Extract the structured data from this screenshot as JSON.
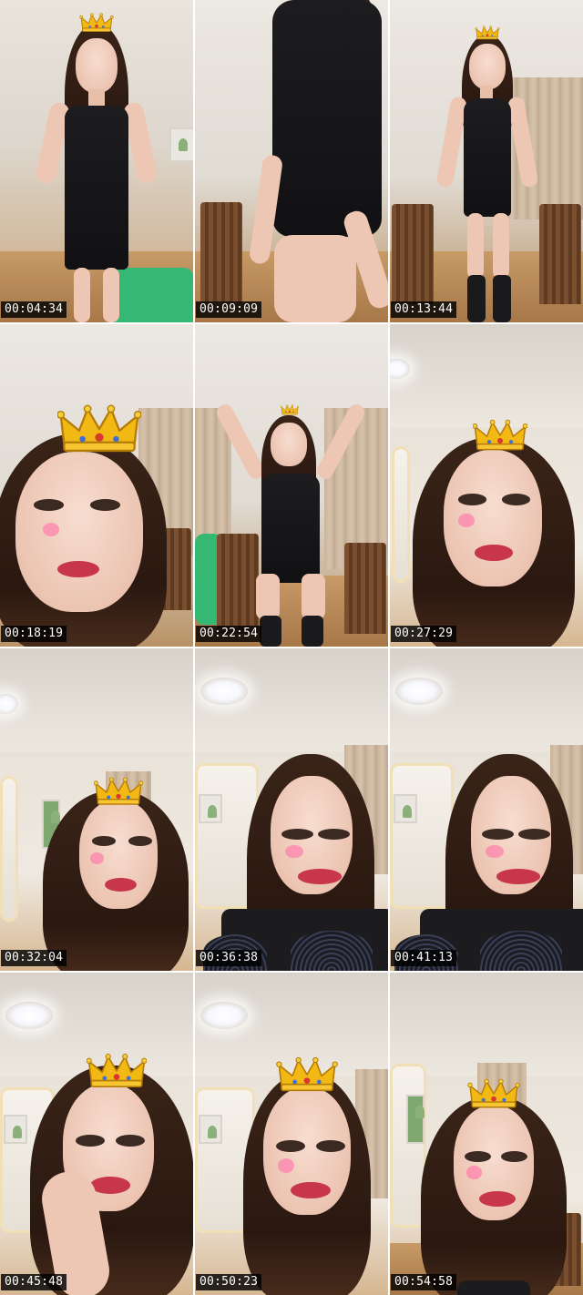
{
  "contact_sheet": {
    "frames": [
      {
        "timestamp": "00:04:34"
      },
      {
        "timestamp": "00:09:09"
      },
      {
        "timestamp": "00:13:44"
      },
      {
        "timestamp": "00:18:19"
      },
      {
        "timestamp": "00:22:54"
      },
      {
        "timestamp": "00:27:29"
      },
      {
        "timestamp": "00:32:04"
      },
      {
        "timestamp": "00:36:38"
      },
      {
        "timestamp": "00:41:13"
      },
      {
        "timestamp": "00:45:48"
      },
      {
        "timestamp": "00:50:23"
      },
      {
        "timestamp": "00:54:58"
      }
    ]
  },
  "colors": {
    "timestamp_bg": "#000000",
    "timestamp_text": "#ffffff",
    "crown_gold": "#f2b814",
    "dress": "#141416"
  },
  "icons": {
    "crown": "crown-icon"
  }
}
